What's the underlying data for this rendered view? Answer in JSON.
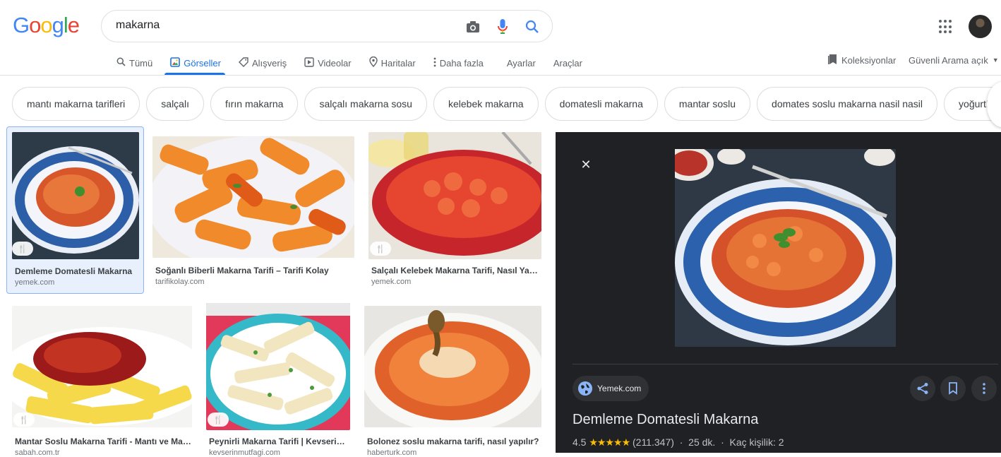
{
  "logo": {
    "letters": [
      "G",
      "o",
      "o",
      "g",
      "l",
      "e"
    ],
    "colors": [
      "#4285f4",
      "#ea4335",
      "#fbbc05",
      "#4285f4",
      "#34a853",
      "#ea4335"
    ]
  },
  "search": {
    "query": "makarna"
  },
  "tabs": [
    {
      "label": "Tümü",
      "icon": "search-icon",
      "active": false
    },
    {
      "label": "Görseller",
      "icon": "image-icon",
      "active": true
    },
    {
      "label": "Alışveriş",
      "icon": "tag-icon",
      "active": false
    },
    {
      "label": "Videolar",
      "icon": "play-icon",
      "active": false
    },
    {
      "label": "Haritalar",
      "icon": "pin-icon",
      "active": false
    },
    {
      "label": "Daha fazla",
      "icon": "more-vert-icon",
      "active": false
    }
  ],
  "tools": {
    "settings": "Ayarlar",
    "tools": "Araçlar"
  },
  "right": {
    "collections": "Koleksiyonlar",
    "safe_search": "Güvenli Arama açık"
  },
  "chips": [
    "mantı makarna tarifleri",
    "salçalı",
    "fırın makarna",
    "salçalı makarna sosu",
    "kelebek makarna",
    "domatesli makarna",
    "mantar soslu",
    "domates soslu makarna nasil nasil",
    "yoğurtlu"
  ],
  "results": [
    {
      "title": "Demleme Domatesli Makarna",
      "source": "yemek.com",
      "recipe": true,
      "selected": true
    },
    {
      "title": "Soğanlı Biberli Makarna Tarifi – Tarifi Kolay",
      "source": "tarifikolay.com",
      "recipe": false,
      "selected": false
    },
    {
      "title": "Salçalı Kelebek Makarna Tarifi, Nasıl Yapılır?",
      "source": "yemek.com",
      "recipe": true,
      "selected": false
    },
    {
      "title": "Mantar Soslu Makarna Tarifi - Mantı ve Makarna",
      "source": "sabah.com.tr",
      "recipe": true,
      "selected": false
    },
    {
      "title": "Peynirli Makarna Tarifi | Kevserin Mutfağı",
      "source": "kevserinmutfagi.com",
      "recipe": true,
      "selected": false
    },
    {
      "title": "Bolonez soslu makarna tarifi, nasıl yapılır?",
      "source": "haberturk.com",
      "recipe": false,
      "selected": false
    }
  ],
  "panel": {
    "source": "Yemek.com",
    "title": "Demleme Domatesli Makarna",
    "rating": "4.5",
    "stars": "★★★★★",
    "reviews": "(211.347)",
    "time": "25 dk.",
    "servings": "Kaç kişilik: 2"
  },
  "colors": {
    "accent": "#1a73e8",
    "panel_bg": "#202124",
    "star": "#fbbc04"
  }
}
